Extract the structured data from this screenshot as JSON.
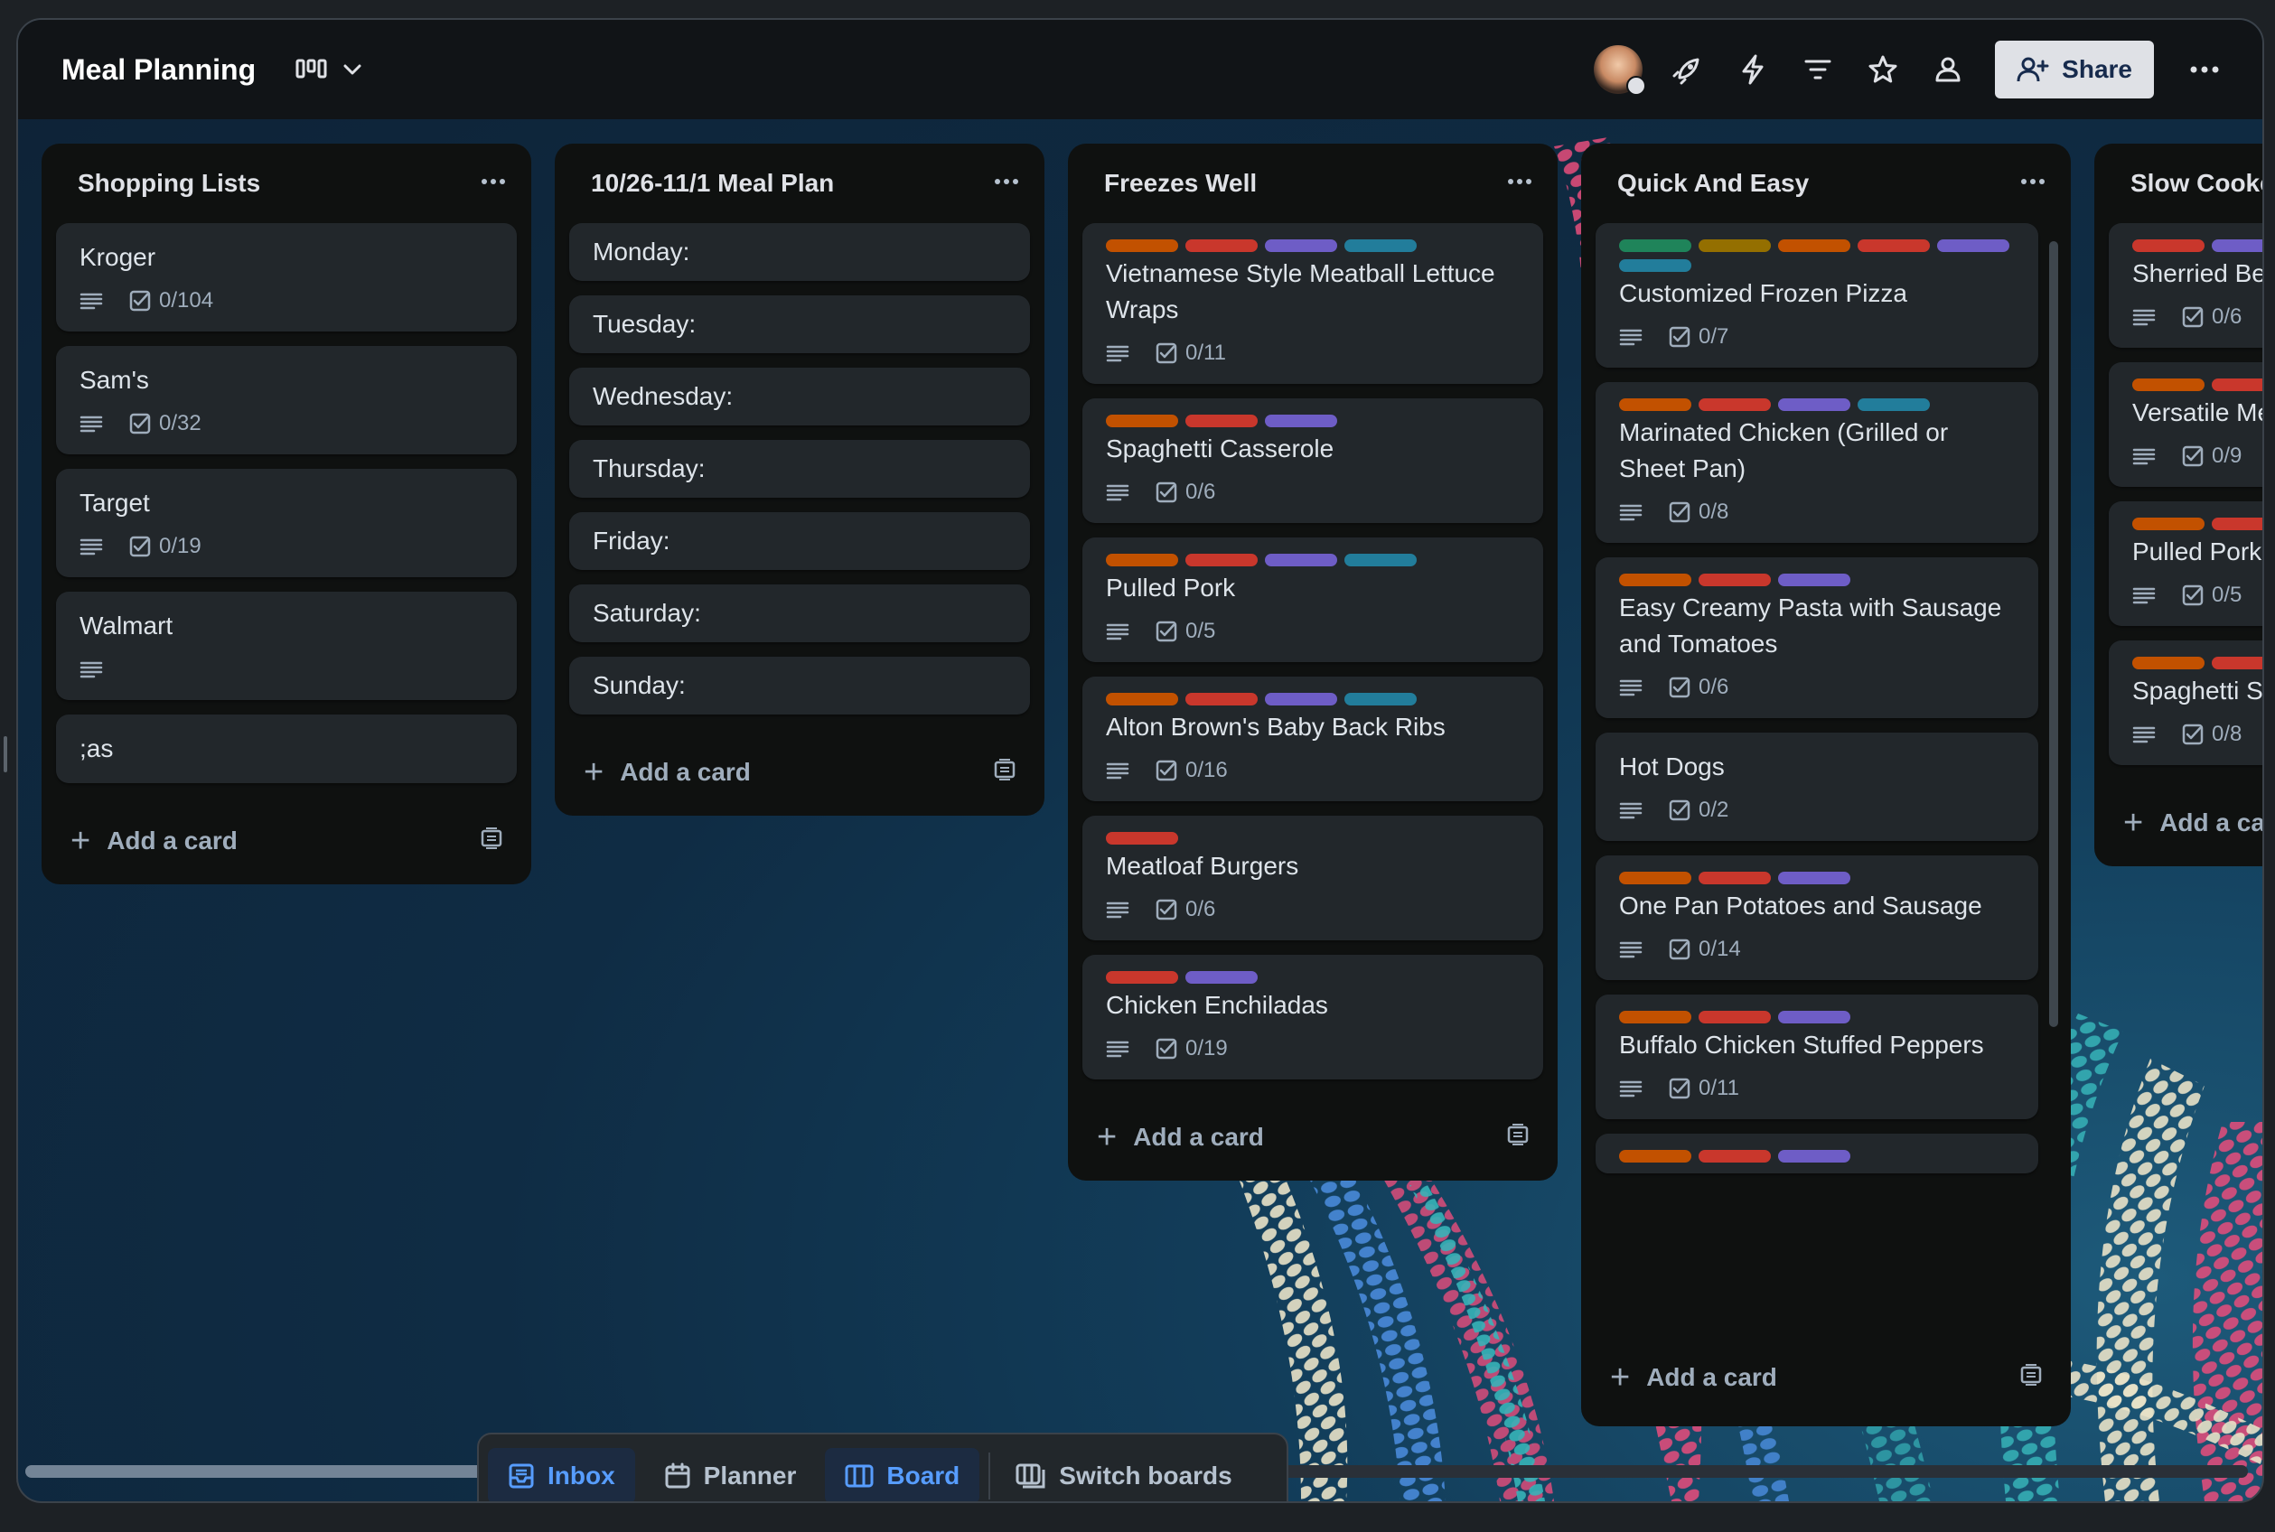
{
  "board": {
    "title": "Meal Planning"
  },
  "header": {
    "share_label": "Share"
  },
  "colors": {
    "orange": "#c25100",
    "red": "#c9372c",
    "purple": "#6e5dc6",
    "teal": "#227d9b",
    "green": "#1f845a",
    "yellow": "#946f00",
    "link": "#579dff"
  },
  "lists": [
    {
      "title": "Shopping Lists",
      "cards": [
        {
          "name": "Kroger",
          "labels": [],
          "desc": true,
          "checklist": "0/104"
        },
        {
          "name": "Sam's",
          "labels": [],
          "desc": true,
          "checklist": "0/32"
        },
        {
          "name": "Target",
          "labels": [],
          "desc": true,
          "checklist": "0/19"
        },
        {
          "name": "Walmart",
          "labels": [],
          "desc": true,
          "checklist": ""
        },
        {
          "name": ";as",
          "labels": [],
          "desc": false,
          "checklist": ""
        }
      ],
      "add_label": "Add a card"
    },
    {
      "title": "10/26-11/1 Meal Plan",
      "cards": [
        {
          "name": "Monday:",
          "labels": [],
          "desc": false,
          "checklist": ""
        },
        {
          "name": "Tuesday:",
          "labels": [],
          "desc": false,
          "checklist": ""
        },
        {
          "name": "Wednesday:",
          "labels": [],
          "desc": false,
          "checklist": ""
        },
        {
          "name": "Thursday:",
          "labels": [],
          "desc": false,
          "checklist": ""
        },
        {
          "name": "Friday:",
          "labels": [],
          "desc": false,
          "checklist": ""
        },
        {
          "name": "Saturday:",
          "labels": [],
          "desc": false,
          "checklist": ""
        },
        {
          "name": "Sunday:",
          "labels": [],
          "desc": false,
          "checklist": ""
        }
      ],
      "add_label": "Add a card"
    },
    {
      "title": "Freezes Well",
      "cards": [
        {
          "name": "Vietnamese Style Meatball Lettuce Wraps",
          "labels": [
            "orange",
            "red",
            "purple",
            "teal"
          ],
          "desc": true,
          "checklist": "0/11"
        },
        {
          "name": "Spaghetti Casserole",
          "labels": [
            "orange",
            "red",
            "purple"
          ],
          "desc": true,
          "checklist": "0/6"
        },
        {
          "name": "Pulled Pork",
          "labels": [
            "orange",
            "red",
            "purple",
            "teal"
          ],
          "desc": true,
          "checklist": "0/5"
        },
        {
          "name": "Alton Brown's Baby Back Ribs",
          "labels": [
            "orange",
            "red",
            "purple",
            "teal"
          ],
          "desc": true,
          "checklist": "0/16"
        },
        {
          "name": "Meatloaf Burgers",
          "labels": [
            "red"
          ],
          "desc": true,
          "checklist": "0/6"
        },
        {
          "name": "Chicken Enchiladas",
          "labels": [
            "red",
            "purple"
          ],
          "desc": true,
          "checklist": "0/19"
        }
      ],
      "add_label": "Add a card"
    },
    {
      "title": "Quick And Easy",
      "cards": [
        {
          "name": "Customized Frozen Pizza",
          "labels": [
            "green",
            "yellow",
            "orange",
            "red",
            "purple",
            "teal"
          ],
          "desc": true,
          "checklist": "0/7"
        },
        {
          "name": "Marinated Chicken (Grilled or Sheet Pan)",
          "labels": [
            "orange",
            "red",
            "purple",
            "teal"
          ],
          "desc": true,
          "checklist": "0/8"
        },
        {
          "name": "Easy Creamy Pasta with Sausage and Tomatoes",
          "labels": [
            "orange",
            "red",
            "purple"
          ],
          "desc": true,
          "checklist": "0/6"
        },
        {
          "name": "Hot Dogs",
          "labels": [],
          "desc": true,
          "checklist": "0/2"
        },
        {
          "name": "One Pan Potatoes and Sausage",
          "labels": [
            "orange",
            "red",
            "purple"
          ],
          "desc": true,
          "checklist": "0/14"
        },
        {
          "name": "Buffalo Chicken Stuffed Peppers",
          "labels": [
            "orange",
            "red",
            "purple"
          ],
          "desc": true,
          "checklist": "0/11"
        },
        {
          "name": "",
          "labels": [
            "orange",
            "red",
            "purple"
          ],
          "desc": false,
          "checklist": ""
        }
      ],
      "add_label": "Add a card"
    },
    {
      "title": "Slow Cooker",
      "cards": [
        {
          "name": "Sherried Beef",
          "labels": [
            "red",
            "purple"
          ],
          "desc": true,
          "checklist": "0/6"
        },
        {
          "name": "Versatile Meatballs",
          "labels": [
            "orange",
            "red"
          ],
          "desc": true,
          "checklist": "0/9"
        },
        {
          "name": "Pulled Pork",
          "labels": [
            "orange",
            "red"
          ],
          "desc": true,
          "checklist": "0/5"
        },
        {
          "name": "Spaghetti Squash Sauce",
          "labels": [
            "orange",
            "red"
          ],
          "desc": true,
          "checklist": "0/8"
        }
      ],
      "add_label": "Add a card"
    }
  ],
  "nav": {
    "inbox": "Inbox",
    "planner": "Planner",
    "board": "Board",
    "switch": "Switch boards"
  }
}
